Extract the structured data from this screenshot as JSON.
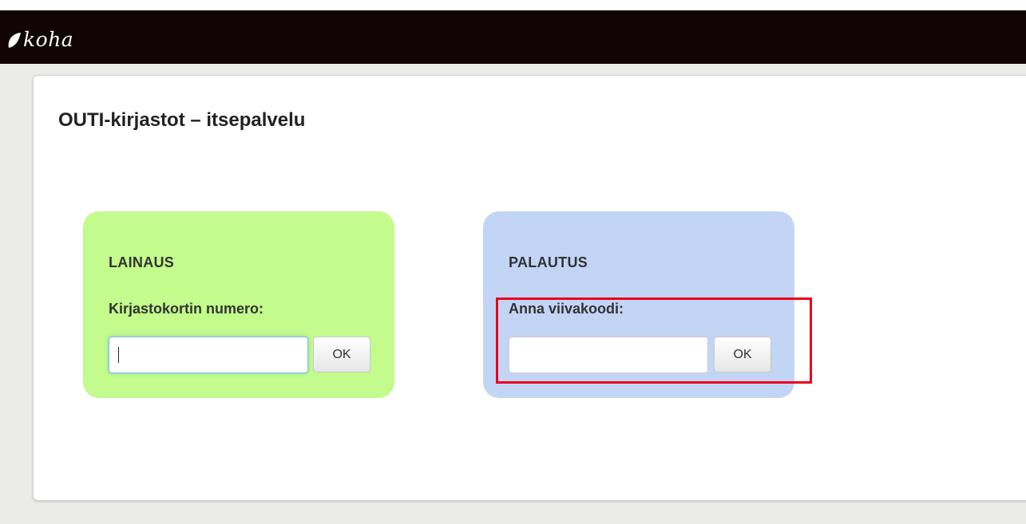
{
  "navbar": {
    "logo_text": "koha"
  },
  "page": {
    "title": "OUTI-kirjastot – itsepalvelu"
  },
  "checkout": {
    "heading": "LAINAUS",
    "field_label": "Kirjastokortin numero:",
    "input_value": "",
    "ok_label": "OK",
    "color": "#c3fb8c"
  },
  "checkin": {
    "heading": "PALAUTUS",
    "field_label": "Anna viivakoodi:",
    "input_value": "",
    "ok_label": "OK",
    "color": "#c2d5f5"
  },
  "annotation": {
    "highlight_color": "#e8001c"
  }
}
